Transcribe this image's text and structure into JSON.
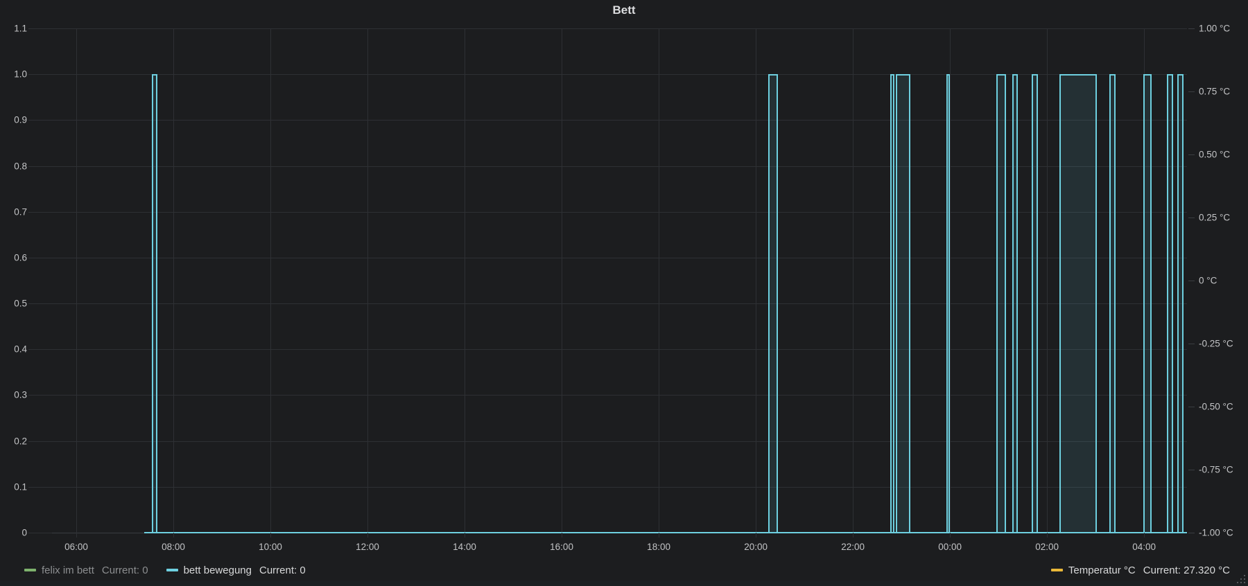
{
  "panel": {
    "title": "Bett"
  },
  "legend": {
    "items": [
      {
        "name": "felix im bett",
        "current": "Current: 0",
        "color": "#7EB26D",
        "hidden": true
      },
      {
        "name": "bett bewegung",
        "current": "Current: 0",
        "color": "#6ED0E0",
        "hidden": false
      },
      {
        "name": "Temperatur °C",
        "current": "Current: 27.320 °C",
        "color": "#EAB839",
        "hidden": false
      }
    ]
  },
  "chart_data": {
    "type": "line",
    "title": "Bett",
    "description": "Digital on/off step chart; 'bett bewegung' pulses between 0 and 1, 'felix im bett' hidden, 'Temperatur °C' not drawn in plot",
    "x_axis": {
      "start": "05:30",
      "end": "04:53",
      "total_min": 1403,
      "ticks": [
        {
          "label": "06:00",
          "min": 30
        },
        {
          "label": "08:00",
          "min": 150
        },
        {
          "label": "10:00",
          "min": 270
        },
        {
          "label": "12:00",
          "min": 390
        },
        {
          "label": "14:00",
          "min": 510
        },
        {
          "label": "16:00",
          "min": 630
        },
        {
          "label": "18:00",
          "min": 750
        },
        {
          "label": "20:00",
          "min": 870
        },
        {
          "label": "22:00",
          "min": 990
        },
        {
          "label": "00:00",
          "min": 1110
        },
        {
          "label": "02:00",
          "min": 1230
        },
        {
          "label": "04:00",
          "min": 1350
        }
      ]
    },
    "y_left": {
      "min": 0,
      "max": 1.1,
      "ticks": [
        {
          "label": "1.1",
          "value": 1.1
        },
        {
          "label": "1.0",
          "value": 1.0
        },
        {
          "label": "0.9",
          "value": 0.9
        },
        {
          "label": "0.8",
          "value": 0.8
        },
        {
          "label": "0.7",
          "value": 0.7
        },
        {
          "label": "0.6",
          "value": 0.6
        },
        {
          "label": "0.5",
          "value": 0.5
        },
        {
          "label": "0.4",
          "value": 0.4
        },
        {
          "label": "0.3",
          "value": 0.3
        },
        {
          "label": "0.2",
          "value": 0.2
        },
        {
          "label": "0.1",
          "value": 0.1
        },
        {
          "label": "0",
          "value": 0
        }
      ]
    },
    "y_right": {
      "min": -1,
      "max": 1,
      "ticks": [
        {
          "label": "1.00 °C",
          "value": 1
        },
        {
          "label": "0.75 °C",
          "value": 0.75
        },
        {
          "label": "0.50 °C",
          "value": 0.5
        },
        {
          "label": "0.25 °C",
          "value": 0.25
        },
        {
          "label": "0 °C",
          "value": 0
        },
        {
          "label": "-0.25 °C",
          "value": -0.25
        },
        {
          "label": "-0.50 °C",
          "value": -0.5
        },
        {
          "label": "-0.75 °C",
          "value": -0.75
        },
        {
          "label": "-1.00 °C",
          "value": -1
        }
      ]
    },
    "series": [
      {
        "name": "felix im bett",
        "color": "#7EB26D",
        "current": 0,
        "hidden": true,
        "pulses": []
      },
      {
        "name": "bett bewegung",
        "color": "#6ED0E0",
        "current": 0,
        "hidden": false,
        "low": 0,
        "high": 1,
        "fill": "rgba(110,208,224,0.11)",
        "data_start": "07:24",
        "data_start_min": 114,
        "pulses": [
          {
            "start": "07:33",
            "end": "07:40",
            "start_min": 123,
            "end_min": 130
          },
          {
            "start": "20:15",
            "end": "20:27",
            "start_min": 885,
            "end_min": 897
          },
          {
            "start": "22:46",
            "end": "22:51",
            "start_min": 1036,
            "end_min": 1041
          },
          {
            "start": "22:53",
            "end": "23:11",
            "start_min": 1043,
            "end_min": 1061
          },
          {
            "start": "23:56",
            "end": "00:00",
            "start_min": 1106,
            "end_min": 1110
          },
          {
            "start": "00:57",
            "end": "01:09",
            "start_min": 1167,
            "end_min": 1179
          },
          {
            "start": "01:17",
            "end": "01:24",
            "start_min": 1187,
            "end_min": 1194
          },
          {
            "start": "01:41",
            "end": "01:49",
            "start_min": 1211,
            "end_min": 1219
          },
          {
            "start": "02:15",
            "end": "03:02",
            "start_min": 1245,
            "end_min": 1292
          },
          {
            "start": "03:17",
            "end": "03:25",
            "start_min": 1307,
            "end_min": 1315
          },
          {
            "start": "03:59",
            "end": "04:09",
            "start_min": 1349,
            "end_min": 1359
          },
          {
            "start": "04:28",
            "end": "04:36",
            "start_min": 1378,
            "end_min": 1386
          },
          {
            "start": "04:41",
            "end": "04:49",
            "start_min": 1391,
            "end_min": 1399
          }
        ]
      },
      {
        "name": "Temperatur °C",
        "color": "#EAB839",
        "current": "27.320 °C",
        "hidden": false,
        "axis": "right",
        "pulses": []
      }
    ],
    "layout": {
      "grid": true,
      "legend_position": "bottom"
    }
  }
}
